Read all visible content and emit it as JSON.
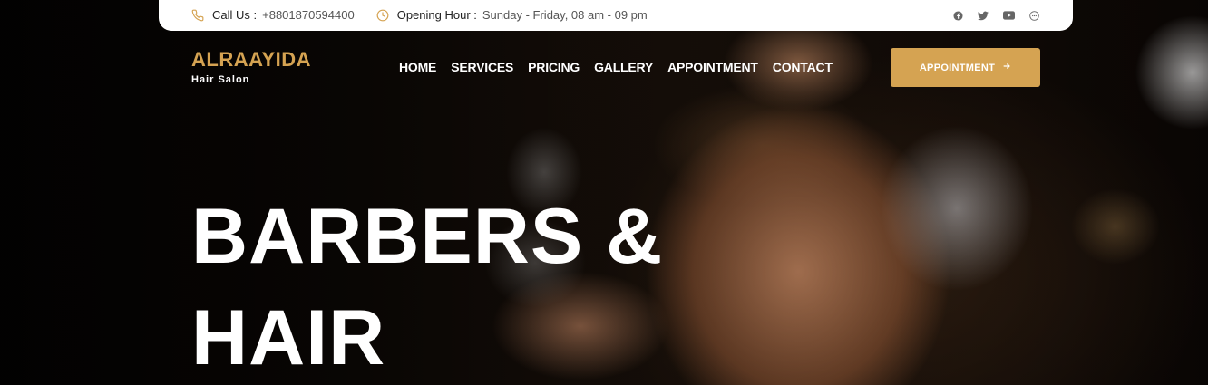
{
  "topbar": {
    "call_label": "Call Us :",
    "call_value": "+8801870594400",
    "hours_label": "Opening Hour :",
    "hours_value": "Sunday - Friday, 08 am - 09 pm",
    "socials": [
      "facebook-icon",
      "twitter-icon",
      "youtube-icon",
      "messenger-icon"
    ],
    "icon_color": "#d5a352"
  },
  "brand": {
    "title": "ALRAAYIDA",
    "subtitle": "Hair Salon",
    "accent": "#d5a352"
  },
  "nav": {
    "items": [
      "HOME",
      "SERVICES",
      "PRICING",
      "GALLERY",
      "APPOINTMENT",
      "CONTACT"
    ]
  },
  "cta": {
    "label": "APPOINTMENT",
    "icon": "arrow-right-icon"
  },
  "hero": {
    "line1": "BARBERS &",
    "line2": "HAIR"
  }
}
